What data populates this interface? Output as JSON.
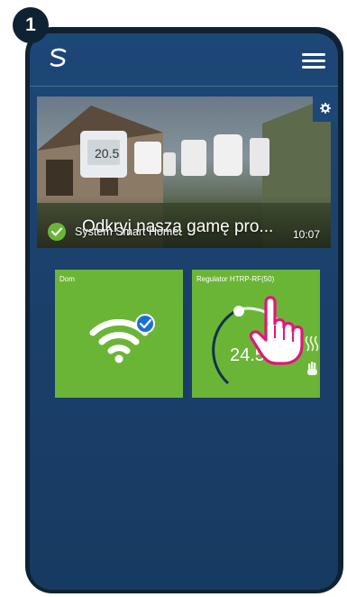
{
  "step_number": "1",
  "header": {
    "logo": "salus-s-logo-icon",
    "menu_icon": "hamburger-menu-icon"
  },
  "banner": {
    "title": "Odkryj naszą gamę pro...",
    "subtitle": "System Smart Home",
    "time": "10:07",
    "status_icon": "check-circle-icon",
    "settings_icon": "gear-icon",
    "thermostat_display": "20.5"
  },
  "tiles": [
    {
      "label": "Dom",
      "icon": "wifi-connected-icon",
      "color": "#6bb536"
    },
    {
      "label": "Regulator HTRP-RF(50)",
      "temperature": "24.5",
      "icons": [
        "heating-waves-icon",
        "hand-manual-icon",
        "tap-hand-pointer-icon"
      ],
      "color": "#6bb536"
    }
  ],
  "colors": {
    "frame": "#0e2233",
    "background": "#1d4777",
    "tile": "#6bb536",
    "pointer": "#e0177a"
  }
}
